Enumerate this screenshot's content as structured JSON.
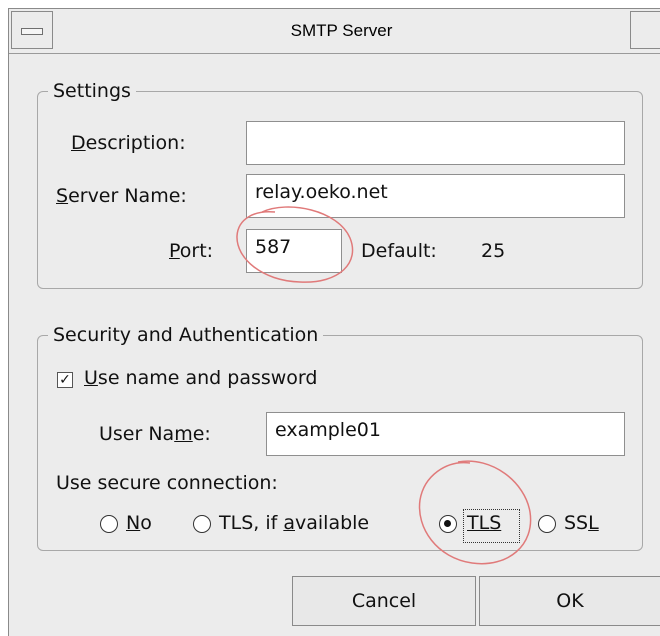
{
  "window": {
    "title": "SMTP Server"
  },
  "settings": {
    "legend": "Settings",
    "description_label": "escription:",
    "description_mnemonic": "D",
    "description_value": "",
    "server_name_label": "erver Name:",
    "server_name_mnemonic": "S",
    "server_name_value": "relay.oeko.net",
    "port_label": "ort:",
    "port_mnemonic": "P",
    "port_value": "587",
    "default_label": "Default:",
    "default_value": "25"
  },
  "security": {
    "legend": "Security and Authentication",
    "use_name_mnemonic": "U",
    "use_name_label": "se name and password",
    "use_name_checked": true,
    "user_name_prefix": "User Na",
    "user_name_mnemonic": "m",
    "user_name_suffix": "e:",
    "user_name_value": "example01",
    "secure_connection_label": "Use secure connection:",
    "options": {
      "no_mnemonic": "N",
      "no_rest": "o",
      "tls_if_available_prefix": "TLS, if ",
      "tls_if_available_mnemonic": "a",
      "tls_if_available_rest": "vailable",
      "tls_label": "TLS",
      "ssl_prefix": "SS",
      "ssl_mnemonic": "L"
    },
    "selected": "TLS"
  },
  "buttons": {
    "cancel": "Cancel",
    "ok": "OK"
  },
  "annotation_color": "#e07a7a",
  "icons": {
    "check": "✓"
  }
}
